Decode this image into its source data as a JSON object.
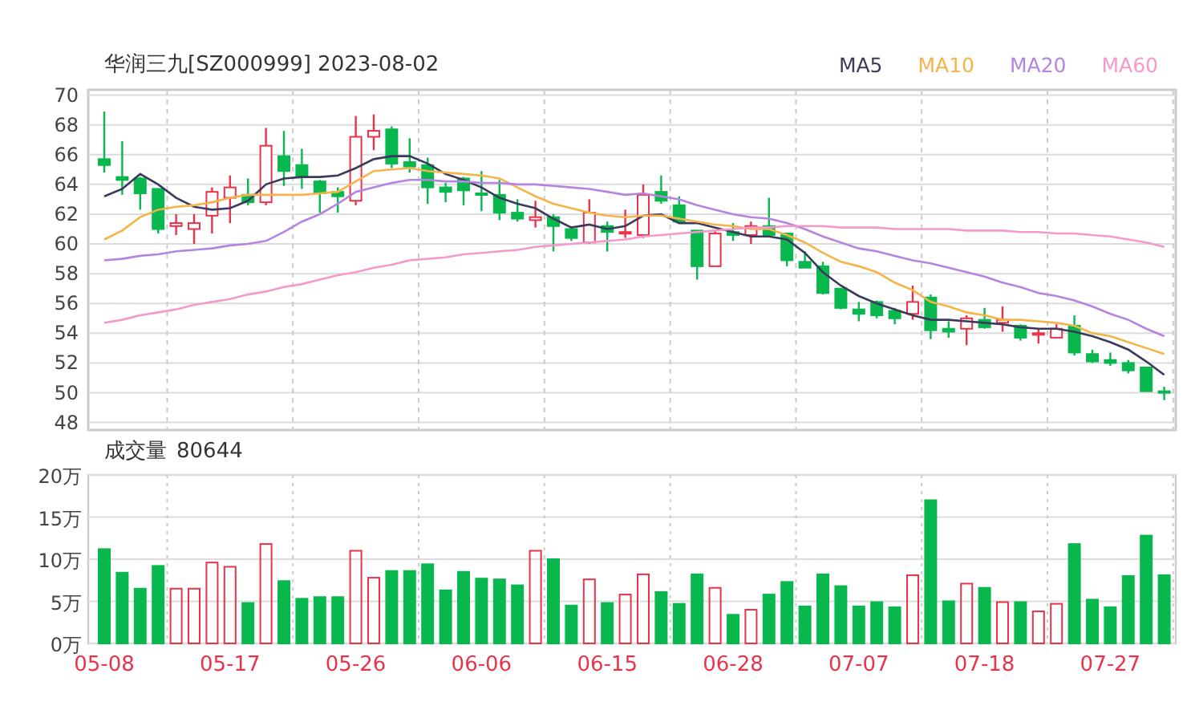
{
  "price_panel": {
    "title": "华润三九[SZ000999] 2023-08-02",
    "chart_data": {
      "type": "candlestick",
      "grid": true,
      "categories": [
        null,
        null,
        null,
        null,
        null,
        null,
        null,
        null,
        null,
        null,
        null,
        null,
        null,
        null,
        null,
        null,
        null,
        null,
        null,
        null,
        null,
        null,
        null,
        null,
        null,
        null,
        null,
        null,
        null,
        null,
        null,
        null,
        null,
        null,
        null,
        null,
        null,
        null,
        null,
        null,
        null,
        null,
        null,
        null,
        null,
        null,
        null,
        null,
        null,
        null,
        null,
        null,
        null,
        null,
        null,
        null,
        null,
        null,
        null,
        null
      ],
      "ylim": [
        48,
        70
      ],
      "yticks": [
        48,
        50,
        52,
        54,
        56,
        58,
        60,
        62,
        64,
        66,
        68,
        70
      ],
      "series": [
        {
          "name": "MA5",
          "type": "line",
          "color": "#3b3a5c",
          "values": [
            63.2,
            63.7,
            64.7,
            64.0,
            63.1,
            62.5,
            62.3,
            62.4,
            62.9,
            64.0,
            64.4,
            64.5,
            64.5,
            64.6,
            65.1,
            65.7,
            65.9,
            65.9,
            65.4,
            64.7,
            64.3,
            63.8,
            63.1,
            62.7,
            62.4,
            61.7,
            61.1,
            61.3,
            61.0,
            61.2,
            61.9,
            62.0,
            61.4,
            61.4,
            61.1,
            60.8,
            60.5,
            60.5,
            60.3,
            59.4,
            58.1,
            57.2,
            56.5,
            56.0,
            55.6,
            55.2,
            54.9,
            54.9,
            54.8,
            54.7,
            54.6,
            54.4,
            54.3,
            54.3,
            54.1,
            53.8,
            53.4,
            52.9,
            52.1,
            51.2
          ]
        },
        {
          "name": "MA10",
          "type": "line",
          "color": "#f5b44a",
          "values": [
            60.3,
            60.9,
            61.8,
            62.3,
            62.5,
            62.6,
            62.8,
            63.1,
            63.3,
            63.3,
            63.3,
            63.3,
            63.4,
            63.5,
            64.2,
            64.9,
            65.0,
            65.1,
            64.9,
            64.8,
            64.7,
            64.6,
            64.4,
            63.8,
            63.2,
            62.7,
            62.4,
            62.1,
            61.9,
            61.8,
            61.9,
            61.9,
            61.7,
            61.5,
            61.3,
            61.2,
            61.0,
            61.0,
            60.6,
            60.1,
            59.4,
            58.8,
            58.5,
            58.1,
            57.4,
            56.9,
            56.1,
            55.8,
            55.4,
            55.2,
            54.9,
            54.9,
            54.8,
            54.7,
            54.5,
            54.0,
            53.8,
            53.4,
            53.0,
            52.6
          ]
        },
        {
          "name": "MA20",
          "type": "line",
          "color": "#b584e0",
          "values": [
            58.9,
            59.0,
            59.2,
            59.3,
            59.5,
            59.6,
            59.7,
            59.9,
            60.0,
            60.2,
            60.8,
            61.5,
            62.0,
            62.7,
            63.5,
            63.8,
            64.1,
            64.3,
            64.3,
            64.2,
            64.2,
            64.1,
            64.1,
            64.0,
            64.0,
            63.9,
            63.8,
            63.7,
            63.5,
            63.3,
            63.4,
            63.2,
            63.0,
            62.6,
            62.3,
            62.0,
            61.8,
            61.7,
            61.4,
            61.0,
            60.5,
            60.1,
            59.7,
            59.5,
            59.2,
            58.9,
            58.7,
            58.4,
            58.1,
            57.8,
            57.4,
            57.1,
            56.7,
            56.5,
            56.2,
            55.8,
            55.3,
            54.9,
            54.3,
            53.8
          ]
        },
        {
          "name": "MA60",
          "type": "line",
          "color": "#f59ac8",
          "values": [
            54.7,
            54.9,
            55.2,
            55.4,
            55.6,
            55.9,
            56.1,
            56.3,
            56.6,
            56.8,
            57.1,
            57.3,
            57.6,
            57.9,
            58.1,
            58.4,
            58.6,
            58.9,
            59.0,
            59.1,
            59.3,
            59.4,
            59.5,
            59.6,
            59.8,
            59.9,
            60.0,
            60.1,
            60.2,
            60.3,
            60.5,
            60.6,
            60.7,
            60.8,
            60.9,
            61.0,
            61.1,
            61.1,
            61.2,
            61.2,
            61.2,
            61.1,
            61.1,
            61.1,
            61.0,
            61.0,
            61.0,
            61.0,
            60.9,
            60.9,
            60.9,
            60.8,
            60.8,
            60.7,
            60.7,
            60.6,
            60.5,
            60.3,
            60.1,
            59.8
          ]
        }
      ],
      "ohlc": [
        [
          65.7,
          68.9,
          64.8,
          65.3
        ],
        [
          64.5,
          66.9,
          63.3,
          64.3
        ],
        [
          64.4,
          64.5,
          62.3,
          63.4
        ],
        [
          63.7,
          63.7,
          60.7,
          61.0
        ],
        [
          61.2,
          62.0,
          60.6,
          61.4
        ],
        [
          61.0,
          62.0,
          60.0,
          61.4
        ],
        [
          61.9,
          63.8,
          60.7,
          63.5
        ],
        [
          63.1,
          64.6,
          61.4,
          63.8
        ],
        [
          63.3,
          64.4,
          62.6,
          62.8
        ],
        [
          62.8,
          67.8,
          62.6,
          66.6
        ],
        [
          65.9,
          67.6,
          63.9,
          64.9
        ],
        [
          65.3,
          66.4,
          63.7,
          64.5
        ],
        [
          64.2,
          64.3,
          62.1,
          63.4
        ],
        [
          63.5,
          63.8,
          62.1,
          63.2
        ],
        [
          62.9,
          68.6,
          62.6,
          67.2
        ],
        [
          67.2,
          68.7,
          66.3,
          67.6
        ],
        [
          67.7,
          67.9,
          65.1,
          65.4
        ],
        [
          65.5,
          67.1,
          64.8,
          65.2
        ],
        [
          65.3,
          65.8,
          62.7,
          63.8
        ],
        [
          63.8,
          64.1,
          62.8,
          63.5
        ],
        [
          64.4,
          64.5,
          62.6,
          63.6
        ],
        [
          63.4,
          64.9,
          62.2,
          63.3
        ],
        [
          63.3,
          64.3,
          61.6,
          62.1
        ],
        [
          62.1,
          63.0,
          61.5,
          61.7
        ],
        [
          61.6,
          62.9,
          61.1,
          61.8
        ],
        [
          61.8,
          62.0,
          59.5,
          61.2
        ],
        [
          61.0,
          61.2,
          60.2,
          60.4
        ],
        [
          60.1,
          63.0,
          60.0,
          62.1
        ],
        [
          61.2,
          61.5,
          59.5,
          60.8
        ],
        [
          60.7,
          62.3,
          60.4,
          60.8
        ],
        [
          60.6,
          64.0,
          60.4,
          63.3
        ],
        [
          63.5,
          64.6,
          62.7,
          62.9
        ],
        [
          62.6,
          63.2,
          61.4,
          61.5
        ],
        [
          60.9,
          60.9,
          57.6,
          58.5
        ],
        [
          58.5,
          60.9,
          58.5,
          60.7
        ],
        [
          60.8,
          61.4,
          60.2,
          60.6
        ],
        [
          60.6,
          61.5,
          60.0,
          61.2
        ],
        [
          61.2,
          63.1,
          60.6,
          60.6
        ],
        [
          60.7,
          60.7,
          58.5,
          58.9
        ],
        [
          58.8,
          59.5,
          58.4,
          58.4
        ],
        [
          58.5,
          58.8,
          56.6,
          56.7
        ],
        [
          57.0,
          57.0,
          55.6,
          55.7
        ],
        [
          55.6,
          56.1,
          54.8,
          55.3
        ],
        [
          56.1,
          56.2,
          55.0,
          55.2
        ],
        [
          55.5,
          55.7,
          54.6,
          55.0
        ],
        [
          55.3,
          57.2,
          54.9,
          56.1
        ],
        [
          56.4,
          56.6,
          53.6,
          54.2
        ],
        [
          54.3,
          54.8,
          53.7,
          54.1
        ],
        [
          54.3,
          55.2,
          53.2,
          55.0
        ],
        [
          54.9,
          55.7,
          54.3,
          54.4
        ],
        [
          54.7,
          55.8,
          54.1,
          54.9
        ],
        [
          54.5,
          54.6,
          53.5,
          53.7
        ],
        [
          53.9,
          54.3,
          53.3,
          54.0
        ],
        [
          53.7,
          54.6,
          53.7,
          54.3
        ],
        [
          54.5,
          55.2,
          52.5,
          52.7
        ],
        [
          52.6,
          52.9,
          52.0,
          52.1
        ],
        [
          52.2,
          52.7,
          51.8,
          52.0
        ],
        [
          52.0,
          52.2,
          51.3,
          51.5
        ],
        [
          51.7,
          51.7,
          50.1,
          50.1
        ],
        [
          50.1,
          50.4,
          49.5,
          50.0
        ]
      ]
    }
  },
  "volume_panel": {
    "value": "80644",
    "chart_data": {
      "type": "bar",
      "grid": true,
      "categories": [
        "05-08",
        null,
        null,
        null,
        null,
        null,
        null,
        "05-17",
        null,
        null,
        null,
        null,
        null,
        null,
        "05-26",
        null,
        null,
        null,
        null,
        null,
        null,
        "06-06",
        null,
        null,
        null,
        null,
        null,
        null,
        "06-15",
        null,
        null,
        null,
        null,
        null,
        null,
        "06-28",
        null,
        null,
        null,
        null,
        null,
        null,
        "07-07",
        null,
        null,
        null,
        null,
        null,
        null,
        "07-18",
        null,
        null,
        null,
        null,
        null,
        null,
        "07-27",
        null,
        null,
        null
      ],
      "ylim": [
        0,
        20
      ],
      "yticks": [
        {
          "value": 0,
          "label": "0万"
        },
        {
          "value": 5,
          "label": "5万"
        },
        {
          "value": 10,
          "label": "10万"
        },
        {
          "value": 15,
          "label": "15万"
        },
        {
          "value": 20,
          "label": "20万"
        }
      ],
      "series": [
        {
          "name": "成交量",
          "color": "#08b84e",
          "values": [
            11.2,
            8.4,
            6.5,
            9.2,
            null,
            null,
            null,
            null,
            4.8,
            null,
            7.4,
            5.3,
            5.5,
            5.5,
            null,
            null,
            8.6,
            8.6,
            9.4,
            6.3,
            8.5,
            7.7,
            7.6,
            6.9,
            null,
            10.0,
            4.5,
            null,
            4.8,
            null,
            null,
            6.1,
            4.7,
            8.2,
            null,
            3.4,
            null,
            5.8,
            7.3,
            4.4,
            8.2,
            6.8,
            4.4,
            4.9,
            4.3,
            null,
            17.0,
            5.0,
            null,
            6.6,
            null,
            4.9,
            null,
            null,
            11.8,
            5.2,
            4.3,
            8.0,
            12.8,
            8.1
          ]
        },
        {
          "color": "#e8334a",
          "values": [
            null,
            null,
            null,
            null,
            6.5,
            6.5,
            9.6,
            9.1,
            null,
            11.8,
            null,
            null,
            null,
            null,
            11.0,
            7.8,
            null,
            null,
            null,
            null,
            null,
            null,
            null,
            null,
            11.0,
            null,
            null,
            7.6,
            null,
            5.8,
            8.2,
            null,
            null,
            null,
            6.6,
            null,
            4.0,
            null,
            null,
            null,
            null,
            null,
            null,
            null,
            null,
            8.1,
            null,
            null,
            7.1,
            null,
            4.9,
            null,
            3.8,
            4.7,
            null,
            null,
            null,
            null,
            null,
            null
          ]
        }
      ]
    }
  }
}
